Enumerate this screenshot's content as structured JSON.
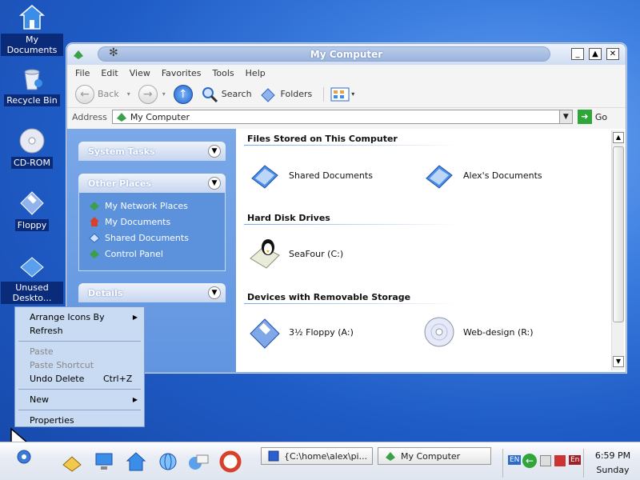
{
  "desktop": {
    "icons": [
      {
        "label": "My Documents"
      },
      {
        "label": "Recycle Bin"
      },
      {
        "label": "CD-ROM"
      },
      {
        "label": "Floppy"
      },
      {
        "label": "Unused Deskto..."
      }
    ]
  },
  "window": {
    "title": "My Computer",
    "controls": {
      "minimize": "_",
      "maximize": "▲",
      "close": "✕"
    },
    "menu": [
      "File",
      "Edit",
      "View",
      "Favorites",
      "Tools",
      "Help"
    ],
    "toolbar": {
      "back": "Back",
      "search": "Search",
      "folders": "Folders"
    },
    "address": {
      "label": "Address",
      "value": "My Computer",
      "go": "Go"
    },
    "left_panels": {
      "system_tasks": "System Tasks",
      "other_places": "Other Places",
      "places": [
        "My Network Places",
        "My Documents",
        "Shared Documents",
        "Control Panel"
      ],
      "details": "Details"
    },
    "sections": {
      "files_stored": "Files Stored on This Computer",
      "hard_disk": "Hard Disk Drives",
      "removable": "Devices with Removable Storage"
    },
    "items": {
      "shared_documents": "Shared Documents",
      "alex_documents": "Alex's Documents",
      "seafour": "SeaFour (C:)",
      "floppy": "3½ Floppy (A:)",
      "web_design": "Web-design (R:)"
    }
  },
  "context_menu": {
    "arrange": "Arrange Icons By",
    "refresh": "Refresh",
    "paste": "Paste",
    "paste_shortcut": "Paste Shortcut",
    "undo_delete": "Undo Delete",
    "undo_shortcut": "Ctrl+Z",
    "new": "New",
    "properties": "Properties"
  },
  "taskbar": {
    "tasks": [
      "{C:\\home\\alex\\pi...",
      "My Computer"
    ],
    "tray": {
      "lang1": "EN",
      "lang2": "En"
    },
    "clock": {
      "time": "6:59 PM",
      "day": "Sunday"
    }
  },
  "colors": {
    "accent": "#1f5cc6",
    "panel": "#5c91dc",
    "title_text": "#ffffff"
  }
}
